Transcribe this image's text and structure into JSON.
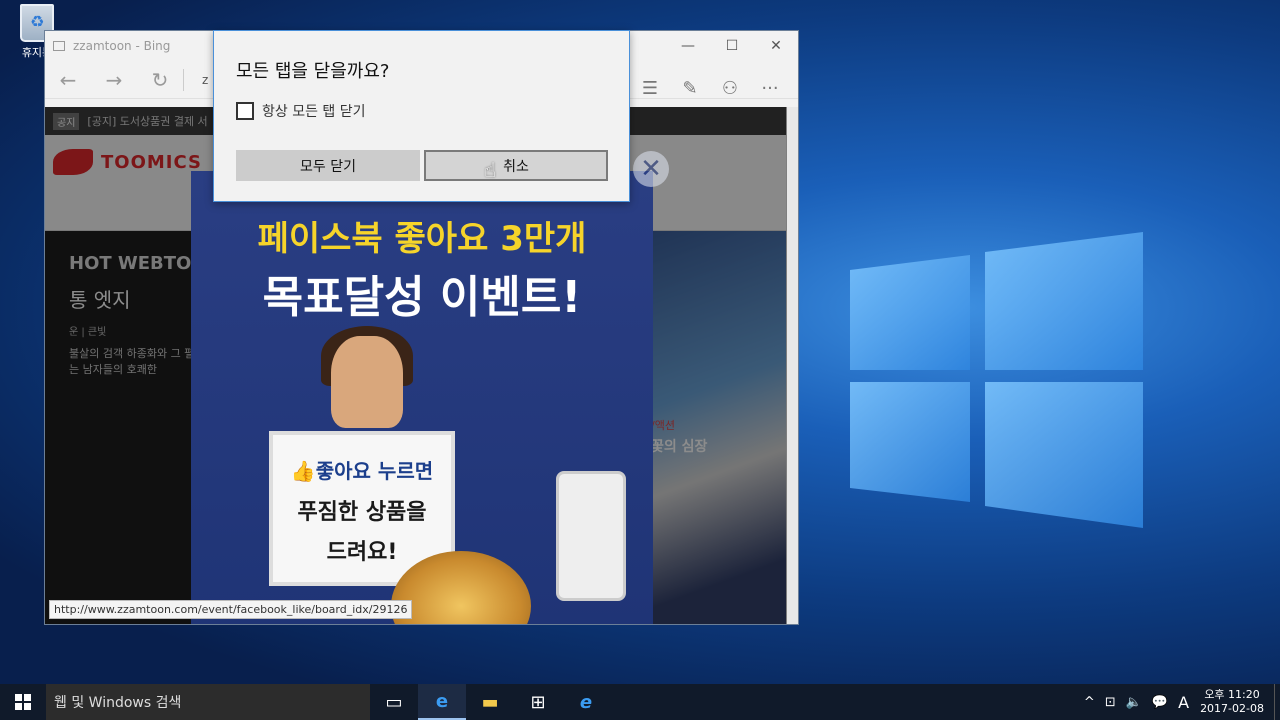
{
  "desktop": {
    "recycle_bin_label": "휴지통"
  },
  "browser": {
    "tab_title": "zzamtoon - Bing",
    "address_initial": "z",
    "window_buttons": {
      "minimize": "—",
      "maximize": "☐",
      "close": "✕"
    },
    "nav": {
      "back": "←",
      "forward": "→",
      "refresh": "↻"
    },
    "toolbar_icons": {
      "hub": "☰",
      "note": "✎",
      "share": "⚇",
      "more": "···"
    }
  },
  "page": {
    "notice_tag": "공지",
    "notice_text": "[공지] 도서상품권 결제 서",
    "logo_text": "TOOMICS",
    "hero_title": "HOT WEBTO",
    "hero_name": "통 엣지",
    "hero_meta": "운 | 큰빛",
    "hero_desc": "불살의 검객 하종화와 그 펼치는 남자들의 호쾌한",
    "right_genre": "/액션",
    "right_caption": "꽃의 심장"
  },
  "popup": {
    "line1": "페이스북 좋아요 3만개",
    "line2": "목표달성 이벤트!",
    "sign_line1": "👍좋아요 누르면",
    "sign_line2": "푸짐한 상품을",
    "sign_line3": "드려요!",
    "close_glyph": "✕"
  },
  "status_url": "http://www.zzamtoon.com/event/facebook_like/board_idx/29126",
  "dialog": {
    "title": "모든 탭을 닫을까요?",
    "checkbox_label": "항상 모든 탭 닫기",
    "checkbox_checked": false,
    "close_all_label": "모두 닫기",
    "cancel_label": "취소"
  },
  "taskbar": {
    "search_placeholder": "웹 및 Windows 검색",
    "tray_icons": [
      "^",
      "⊡",
      "🔈",
      "💬"
    ],
    "ime_label": "A",
    "clock_time": "오후 11:20",
    "clock_date": "2017-02-08"
  }
}
